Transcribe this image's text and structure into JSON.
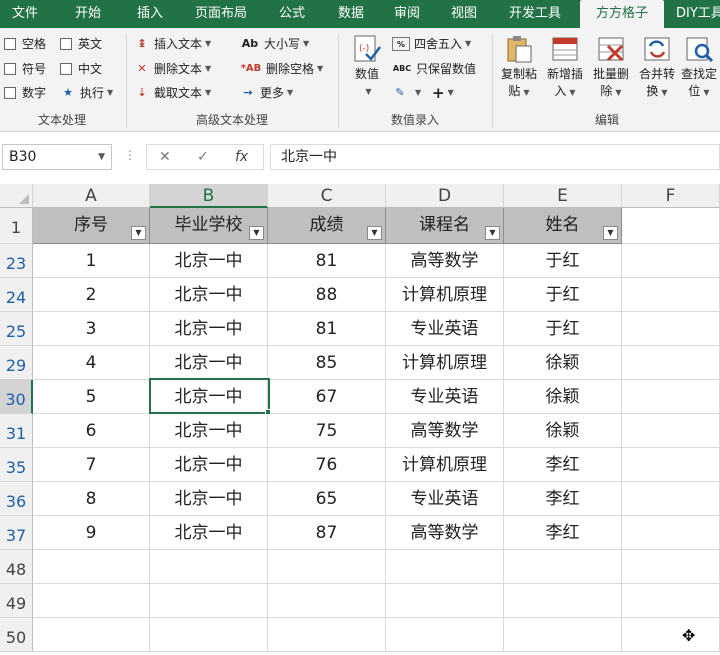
{
  "ribbon_tabs": [
    "文件",
    "开始",
    "插入",
    "页面布局",
    "公式",
    "数据",
    "审阅",
    "视图",
    "开发工具",
    "方方格子",
    "DIY工具箱"
  ],
  "active_tab": "方方格子",
  "text_processing": {
    "checkboxes": [
      "空格",
      "英文",
      "符号",
      "中文",
      "数字"
    ],
    "execute_label": "执行",
    "group_label": "文本处理"
  },
  "advanced_text": {
    "items": [
      "插入文本",
      "删除文本",
      "截取文本",
      "大小写",
      "删除空格",
      "更多"
    ],
    "group_label": "高级文本处理"
  },
  "numeric_entry": {
    "value_button": "数值",
    "round_label": "四舍五入",
    "keep_values_label": "只保留数值",
    "group_label": "数值录入"
  },
  "editing": {
    "buttons": [
      {
        "l1": "复制粘",
        "l2": "贴"
      },
      {
        "l1": "新增插",
        "l2": "入"
      },
      {
        "l1": "批量删",
        "l2": "除"
      },
      {
        "l1": "合并转",
        "l2": "换"
      },
      {
        "l1": "查找定",
        "l2": "位"
      }
    ],
    "group_label": "编辑"
  },
  "formula_bar": {
    "name_box": "B30",
    "fx_label": "fx",
    "content": "北京一中"
  },
  "sheet": {
    "columns": [
      "A",
      "B",
      "C",
      "D",
      "E",
      "F"
    ],
    "selected_column": "B",
    "header_row_number": "1",
    "headers": [
      "序号",
      "毕业学校",
      "成绩",
      "课程名",
      "姓名"
    ],
    "rows": [
      {
        "row": "23",
        "cells": [
          "1",
          "北京一中",
          "81",
          "高等数学",
          "于红"
        ]
      },
      {
        "row": "24",
        "cells": [
          "2",
          "北京一中",
          "88",
          "计算机原理",
          "于红"
        ]
      },
      {
        "row": "25",
        "cells": [
          "3",
          "北京一中",
          "81",
          "专业英语",
          "于红"
        ]
      },
      {
        "row": "29",
        "cells": [
          "4",
          "北京一中",
          "85",
          "计算机原理",
          "徐颖"
        ]
      },
      {
        "row": "30",
        "cells": [
          "5",
          "北京一中",
          "67",
          "专业英语",
          "徐颖"
        ]
      },
      {
        "row": "31",
        "cells": [
          "6",
          "北京一中",
          "75",
          "高等数学",
          "徐颖"
        ]
      },
      {
        "row": "35",
        "cells": [
          "7",
          "北京一中",
          "76",
          "计算机原理",
          "李红"
        ]
      },
      {
        "row": "36",
        "cells": [
          "8",
          "北京一中",
          "65",
          "专业英语",
          "李红"
        ]
      },
      {
        "row": "37",
        "cells": [
          "9",
          "北京一中",
          "87",
          "高等数学",
          "李红"
        ]
      }
    ],
    "empty_rows": [
      "48",
      "49",
      "50"
    ],
    "selected_row": "30"
  },
  "colors": {
    "ribbon_green": "#217346",
    "header_fill": "#bfbfbf",
    "filtered_row_number": "#1f5fa8"
  }
}
